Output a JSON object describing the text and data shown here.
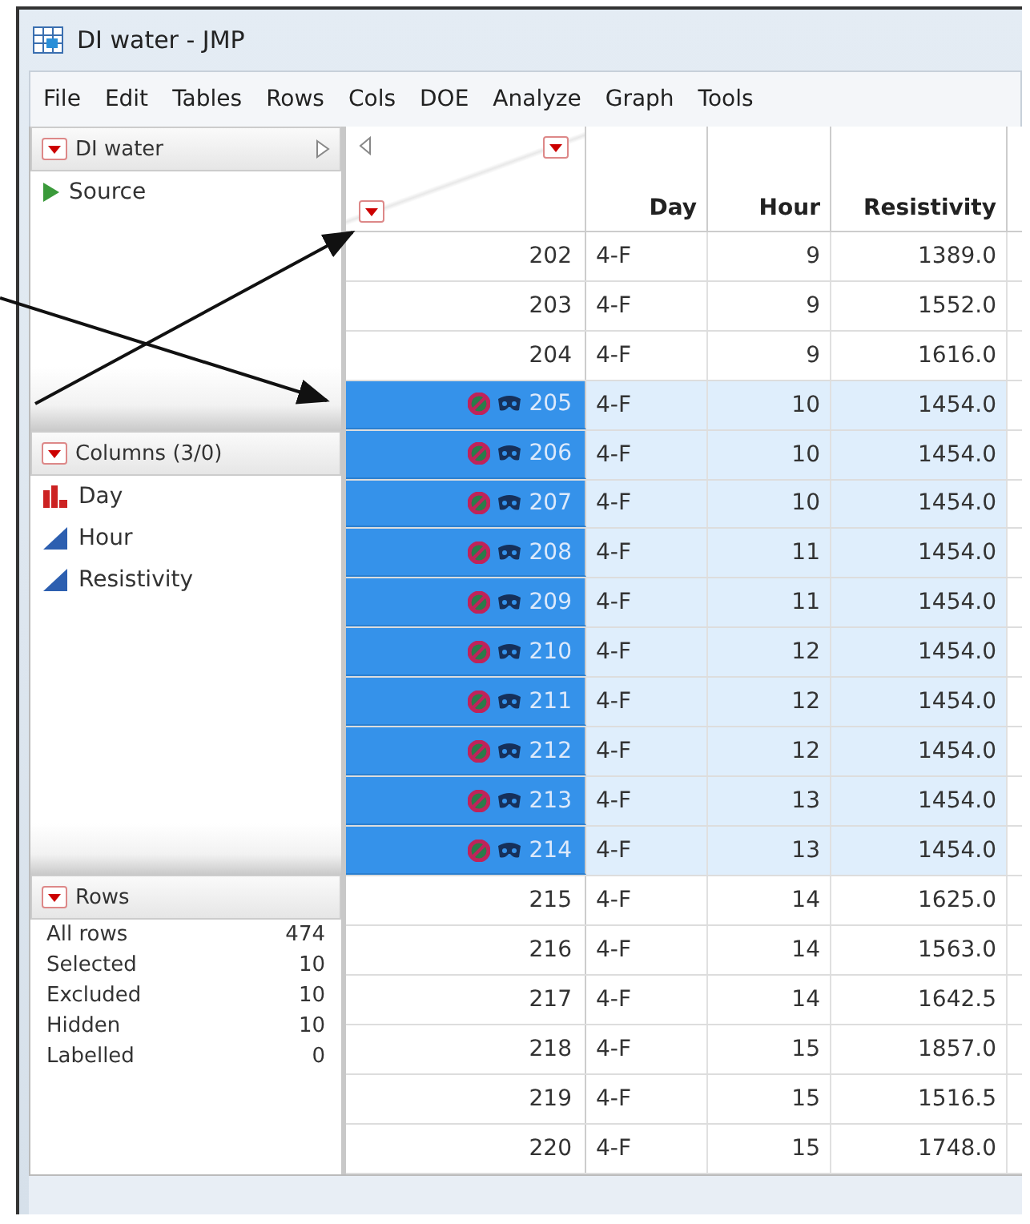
{
  "window": {
    "title": "DI water - JMP"
  },
  "menu": [
    "File",
    "Edit",
    "Tables",
    "Rows",
    "Cols",
    "DOE",
    "Analyze",
    "Graph",
    "Tools"
  ],
  "table_panel": {
    "title": "DI water",
    "items": [
      "Source"
    ]
  },
  "columns_panel": {
    "title": "Columns (3/0)",
    "columns": [
      {
        "name": "Day",
        "kind": "nominal"
      },
      {
        "name": "Hour",
        "kind": "continuous"
      },
      {
        "name": "Resistivity",
        "kind": "continuous"
      }
    ]
  },
  "rows_panel": {
    "title": "Rows",
    "stats": [
      {
        "label": "All rows",
        "value": "474"
      },
      {
        "label": "Selected",
        "value": "10"
      },
      {
        "label": "Excluded",
        "value": "10"
      },
      {
        "label": "Hidden",
        "value": "10"
      },
      {
        "label": "Labelled",
        "value": "0"
      }
    ]
  },
  "table": {
    "columns": [
      "Day",
      "Hour",
      "Resistivity"
    ],
    "rows": [
      {
        "row": "202",
        "day": "4-F",
        "hour": "9",
        "resistivity": "1389.0",
        "selected": false,
        "excluded": false,
        "hidden": false
      },
      {
        "row": "203",
        "day": "4-F",
        "hour": "9",
        "resistivity": "1552.0",
        "selected": false,
        "excluded": false,
        "hidden": false
      },
      {
        "row": "204",
        "day": "4-F",
        "hour": "9",
        "resistivity": "1616.0",
        "selected": false,
        "excluded": false,
        "hidden": false
      },
      {
        "row": "205",
        "day": "4-F",
        "hour": "10",
        "resistivity": "1454.0",
        "selected": true,
        "excluded": true,
        "hidden": true
      },
      {
        "row": "206",
        "day": "4-F",
        "hour": "10",
        "resistivity": "1454.0",
        "selected": true,
        "excluded": true,
        "hidden": true
      },
      {
        "row": "207",
        "day": "4-F",
        "hour": "10",
        "resistivity": "1454.0",
        "selected": true,
        "excluded": true,
        "hidden": true
      },
      {
        "row": "208",
        "day": "4-F",
        "hour": "11",
        "resistivity": "1454.0",
        "selected": true,
        "excluded": true,
        "hidden": true
      },
      {
        "row": "209",
        "day": "4-F",
        "hour": "11",
        "resistivity": "1454.0",
        "selected": true,
        "excluded": true,
        "hidden": true
      },
      {
        "row": "210",
        "day": "4-F",
        "hour": "12",
        "resistivity": "1454.0",
        "selected": true,
        "excluded": true,
        "hidden": true
      },
      {
        "row": "211",
        "day": "4-F",
        "hour": "12",
        "resistivity": "1454.0",
        "selected": true,
        "excluded": true,
        "hidden": true
      },
      {
        "row": "212",
        "day": "4-F",
        "hour": "12",
        "resistivity": "1454.0",
        "selected": true,
        "excluded": true,
        "hidden": true
      },
      {
        "row": "213",
        "day": "4-F",
        "hour": "13",
        "resistivity": "1454.0",
        "selected": true,
        "excluded": true,
        "hidden": true
      },
      {
        "row": "214",
        "day": "4-F",
        "hour": "13",
        "resistivity": "1454.0",
        "selected": true,
        "excluded": true,
        "hidden": true
      },
      {
        "row": "215",
        "day": "4-F",
        "hour": "14",
        "resistivity": "1625.0",
        "selected": false,
        "excluded": false,
        "hidden": false
      },
      {
        "row": "216",
        "day": "4-F",
        "hour": "14",
        "resistivity": "1563.0",
        "selected": false,
        "excluded": false,
        "hidden": false
      },
      {
        "row": "217",
        "day": "4-F",
        "hour": "14",
        "resistivity": "1642.5",
        "selected": false,
        "excluded": false,
        "hidden": false
      },
      {
        "row": "218",
        "day": "4-F",
        "hour": "15",
        "resistivity": "1857.0",
        "selected": false,
        "excluded": false,
        "hidden": false
      },
      {
        "row": "219",
        "day": "4-F",
        "hour": "15",
        "resistivity": "1516.5",
        "selected": false,
        "excluded": false,
        "hidden": false
      },
      {
        "row": "220",
        "day": "4-F",
        "hour": "15",
        "resistivity": "1748.0",
        "selected": false,
        "excluded": false,
        "hidden": false
      }
    ]
  }
}
